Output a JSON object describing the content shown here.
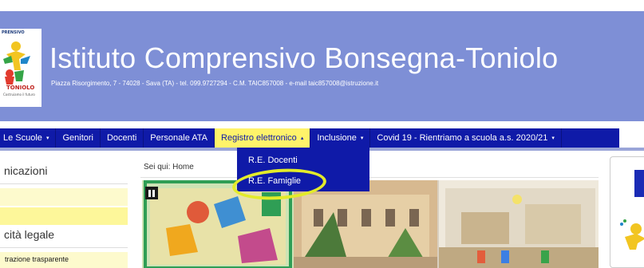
{
  "header": {
    "logo_small_text": "PRENSIVO",
    "logo_name": "TONIOLO",
    "logo_tagline": "Costruiamo il futuro",
    "title": "Istituto Comprensivo Bonsegna-Toniolo",
    "address": "Piazza Risorgimento, 7 - 74028 - Sava (TA) - tel. 099.9727294 - C.M. TAIC857008 - e-mail taic857008@istruzione.it"
  },
  "nav": {
    "items": [
      {
        "label": "Le Scuole",
        "dropdown": true
      },
      {
        "label": "Genitori",
        "dropdown": false
      },
      {
        "label": "Docenti",
        "dropdown": false
      },
      {
        "label": "Personale ATA",
        "dropdown": false
      },
      {
        "label": "Registro elettronico",
        "dropdown": true,
        "active": true
      },
      {
        "label": "Inclusione",
        "dropdown": true
      },
      {
        "label": "Covid 19 - Rientriamo a scuola a.s. 2020/21",
        "dropdown": true
      }
    ],
    "caret_down": "▾",
    "caret_up": "▴"
  },
  "dropdown": {
    "items": [
      {
        "label": "R.E. Docenti"
      },
      {
        "label": "R.E. Famiglie",
        "circled": true
      }
    ]
  },
  "sidebar": {
    "section1_heading": "nicazioni",
    "section2_heading": "cità legale",
    "section2_item": "trazione trasparente"
  },
  "breadcrumb": {
    "text": "Sei qui:  Home"
  },
  "slideshow": {
    "control": "pause"
  },
  "icons": {
    "pause": "pause-icon",
    "caret": "caret-icon"
  },
  "colors": {
    "header_bg": "#7e8fd6",
    "nav_bg": "#0f1aa8",
    "nav_active_bg": "#fff36a",
    "highlight_ring": "#e3eb2a",
    "sidebar_yellow": "#fdf79a"
  }
}
